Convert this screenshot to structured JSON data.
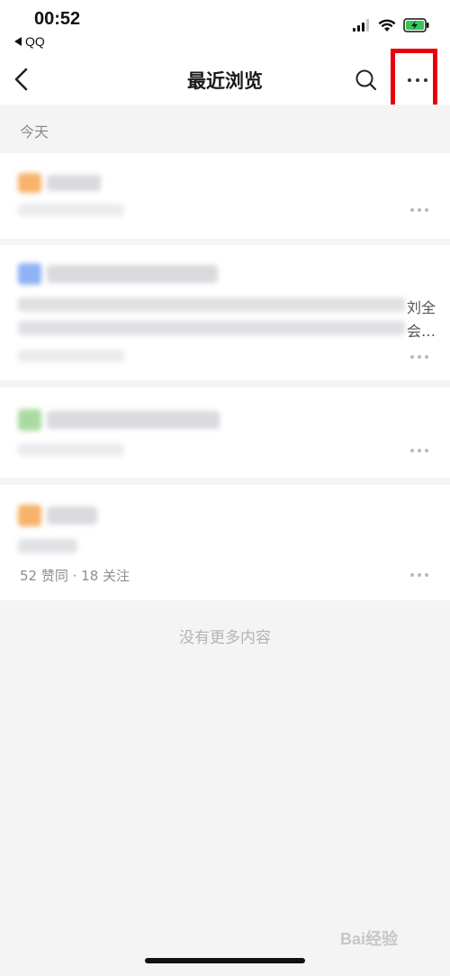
{
  "status_bar": {
    "time": "00:52",
    "back_app": "QQ"
  },
  "nav": {
    "title": "最近浏览"
  },
  "section": {
    "label": "今天"
  },
  "items": [
    {
      "peek_text": ""
    },
    {
      "peek_line1": "刘全",
      "peek_line2": "会…"
    },
    {
      "peek_text": ""
    },
    {
      "meta": "52 赞同 · 18 关注"
    }
  ],
  "footer": {
    "empty_note": "没有更多内容"
  },
  "watermark": {
    "text": "Bai经验"
  },
  "colors": {
    "highlight": "#e8000a",
    "orange": "#f7b26b",
    "blue": "#8fb2f5",
    "green": "#a9dba0"
  }
}
